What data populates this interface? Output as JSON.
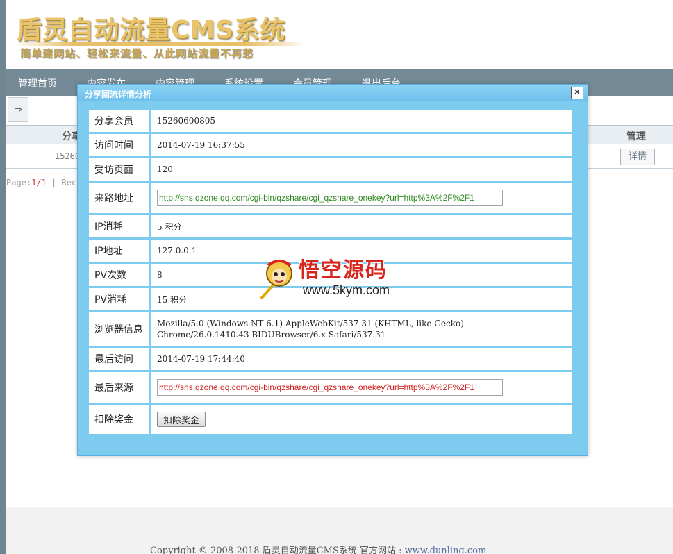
{
  "header": {
    "logo_title": "盾灵自动流量CMS系统",
    "logo_slogan": "简单建网站、轻松来流量、从此网站流量不再愁"
  },
  "nav": {
    "items": [
      "管理首页",
      "内容发布",
      "内容管理",
      "系统设置",
      "会员管理",
      "退出后台"
    ]
  },
  "toolbar": {
    "arrow_icon": "⇒"
  },
  "table": {
    "headers": {
      "member": "分享",
      "manage": "管理"
    },
    "rows": [
      {
        "member": "15260",
        "action": "详情"
      }
    ]
  },
  "pager": {
    "prefix": "Page:",
    "current": "1/1",
    "separator": " | ",
    "records": "Reco"
  },
  "dialog": {
    "title": "分享回流详情分析",
    "close_icon": "✕",
    "fields": [
      {
        "label": "分享会员",
        "value": "15260600805"
      },
      {
        "label": "访问时间",
        "value": "2014-07-19 16:37:55"
      },
      {
        "label": "受访页面",
        "value": "120"
      },
      {
        "label": "来路地址",
        "value": "http://sns.qzone.qq.com/cgi-bin/qzshare/cgi_qzshare_onekey?url=http%3A%2F%2F1"
      },
      {
        "label": "IP消耗",
        "value": "5 积分"
      },
      {
        "label": "IP地址",
        "value": "127.0.0.1"
      },
      {
        "label": "PV次数",
        "value": "8"
      },
      {
        "label": "PV消耗",
        "value": "15 积分"
      },
      {
        "label": "浏览器信息",
        "value_line1": "Mozilla/5.0 (Windows NT 6.1) AppleWebKit/537.31 (KHTML, like Gecko)",
        "value_line2": "Chrome/26.0.1410.43 BIDUBrowser/6.x Safari/537.31"
      },
      {
        "label": "最后访问",
        "value": "2014-07-19 17:44:40"
      },
      {
        "label": "最后来源",
        "value": "http://sns.qzone.qq.com/cgi-bin/qzshare/cgi_qzshare_onekey?url=http%3A%2F%2F1"
      },
      {
        "label": "扣除奖金",
        "button": "扣除奖金"
      }
    ]
  },
  "watermark": {
    "title": "悟空源码",
    "url": "www.5kym.com"
  },
  "footer": {
    "copyright": "Copyright © 2008-2018 盾灵自动流量CMS系统 官方网站 : ",
    "link": "www.dunling.com"
  },
  "colors": {
    "nav_bg": "#748a96",
    "dialog_bg": "#7ecbf0",
    "url_green": "#2f8a20",
    "url_red": "#d21e1e"
  }
}
